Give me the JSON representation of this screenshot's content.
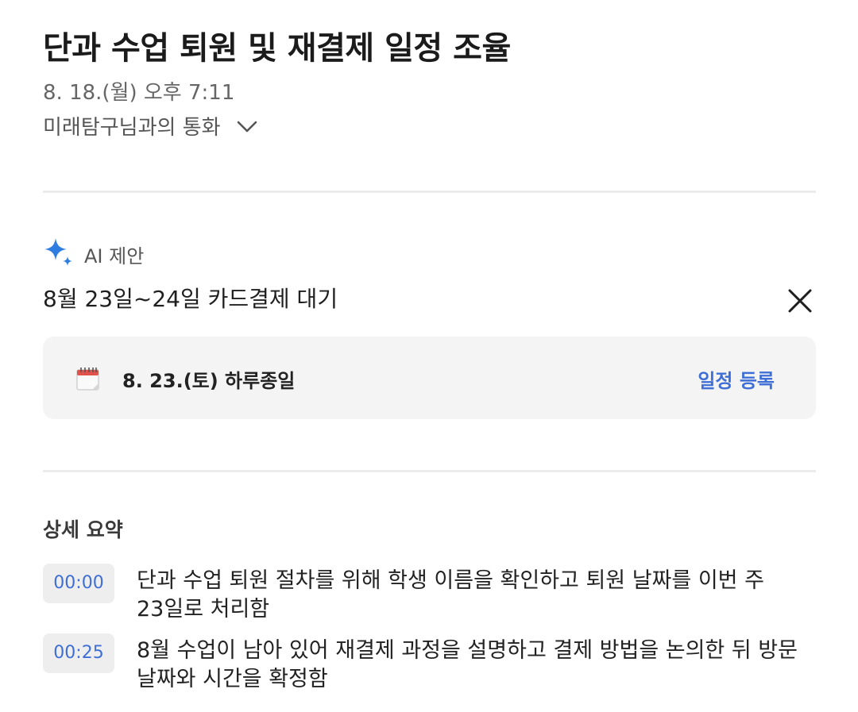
{
  "header": {
    "title": "단과 수업 퇴원 및 재결제 일정 조율",
    "datetime": "8. 18.(월) 오후 7:11",
    "caller": "미래탐구님과의 통화"
  },
  "ai_suggestion": {
    "label": "AI 제안",
    "text": "8월 23일~24일 카드결제 대기",
    "event": {
      "date": "8. 23.(토) 하루종일",
      "action": "일정 등록"
    }
  },
  "summary": {
    "heading": "상세 요약",
    "items": [
      {
        "time": "00:00",
        "text": "단과 수업 퇴원 절차를 위해 학생 이름을 확인하고 퇴원 날짜를 이번 주 23일로 처리함"
      },
      {
        "time": "00:25",
        "text": "8월 수업이 남아 있어 재결제 과정을 설명하고 결제 방법을 논의한 뒤 방문 날짜와 시간을 확정함"
      }
    ]
  },
  "colors": {
    "accent": "#3f6fd6",
    "ai_sparkle": "#2f7de0",
    "card_bg": "#f4f4f4"
  },
  "icons": {
    "caller_toggle": "chevron-down-icon",
    "ai": "sparkle-icon",
    "close": "close-icon",
    "event": "calendar-icon"
  }
}
